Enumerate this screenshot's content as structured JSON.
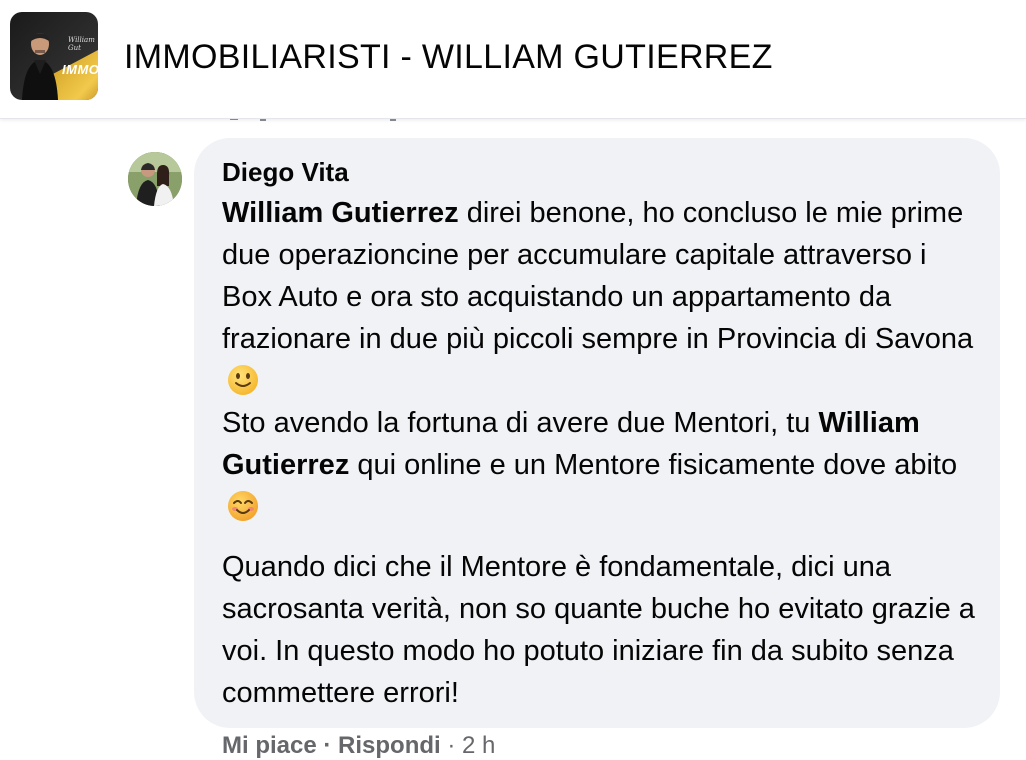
{
  "header": {
    "group_name": "IMMOBILIARISTI - WILLIAM GUTIERREZ",
    "thumb_text": "IMMO",
    "thumb_signature": "William Gut"
  },
  "comment": {
    "author": "Diego Vita",
    "paragraph1": {
      "mention1": "William Gutierrez",
      "text1": " direi benone, ho concluso le mie prime due operazioncine per accumulare capitale attraverso i Box Auto e ora sto acquistando un appartamento da frazionare in due più piccoli sempre in Provincia di Savona",
      "emoji1": "slightly-smiling-face-icon",
      "text2": "Sto avendo la fortuna di avere due Mentori, tu ",
      "mention2": "William Gutierrez",
      "text3": " qui online e un Mentore fisicamente dove abito",
      "emoji2": "smiling-face-with-smiling-eyes-icon"
    },
    "paragraph2": "Quando dici che il Mentore è fondamentale, dici una sacrosanta verità, non so quante buche ho evitato grazie a voi. In questo modo ho potuto iniziare fin da subito senza commettere errori!",
    "bubble_color": "#f0f2f5"
  },
  "actions": {
    "like": "Mi piace",
    "separator": " · ",
    "reply": "Rispondi",
    "time": " · 2 h"
  }
}
